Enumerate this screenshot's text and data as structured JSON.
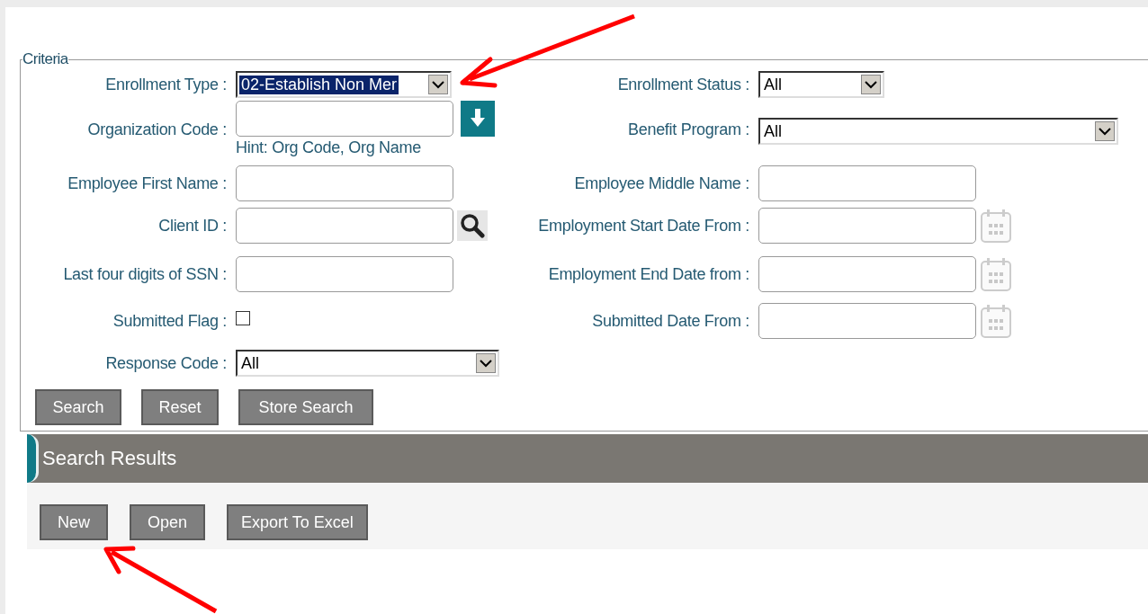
{
  "criteria": {
    "legend": "Criteria",
    "rows": [
      {
        "left": {
          "label": "Enrollment Type :",
          "kind": "select",
          "value": "02-Establish Non Mer",
          "focused": true
        },
        "right": {
          "label": "Enrollment Status :",
          "kind": "select",
          "value": "All",
          "focused": false
        }
      },
      {
        "left": {
          "label": "Organization Code :",
          "kind": "lookup",
          "hint": "Hint: Org Code, Org Name"
        },
        "right": {
          "label": "Benefit Program :",
          "kind": "select",
          "value": "All",
          "focused": false
        }
      },
      {
        "left": {
          "label": "Employee First Name :",
          "kind": "text"
        },
        "right": {
          "label": "Employee Middle Name :",
          "kind": "text"
        }
      },
      {
        "left": {
          "label": "Client ID :",
          "kind": "search"
        },
        "right": {
          "label": "Employment Start Date From :",
          "kind": "date"
        }
      },
      {
        "left": {
          "label": "Last four digits of SSN :",
          "kind": "text"
        },
        "right": {
          "label": "Employment End Date from :",
          "kind": "date"
        }
      },
      {
        "left": {
          "label": "Submitted Flag :",
          "kind": "checkbox",
          "checked": false
        },
        "right": {
          "label": "Submitted Date From :",
          "kind": "date"
        }
      },
      {
        "left": {
          "label": "Response Code :",
          "kind": "select",
          "value": "All",
          "focused": false
        }
      }
    ],
    "buttons": [
      "Search",
      "Reset",
      "Store Search"
    ]
  },
  "results": {
    "title": "Search Results",
    "buttons": [
      "New",
      "Open",
      "Export To Excel"
    ]
  }
}
